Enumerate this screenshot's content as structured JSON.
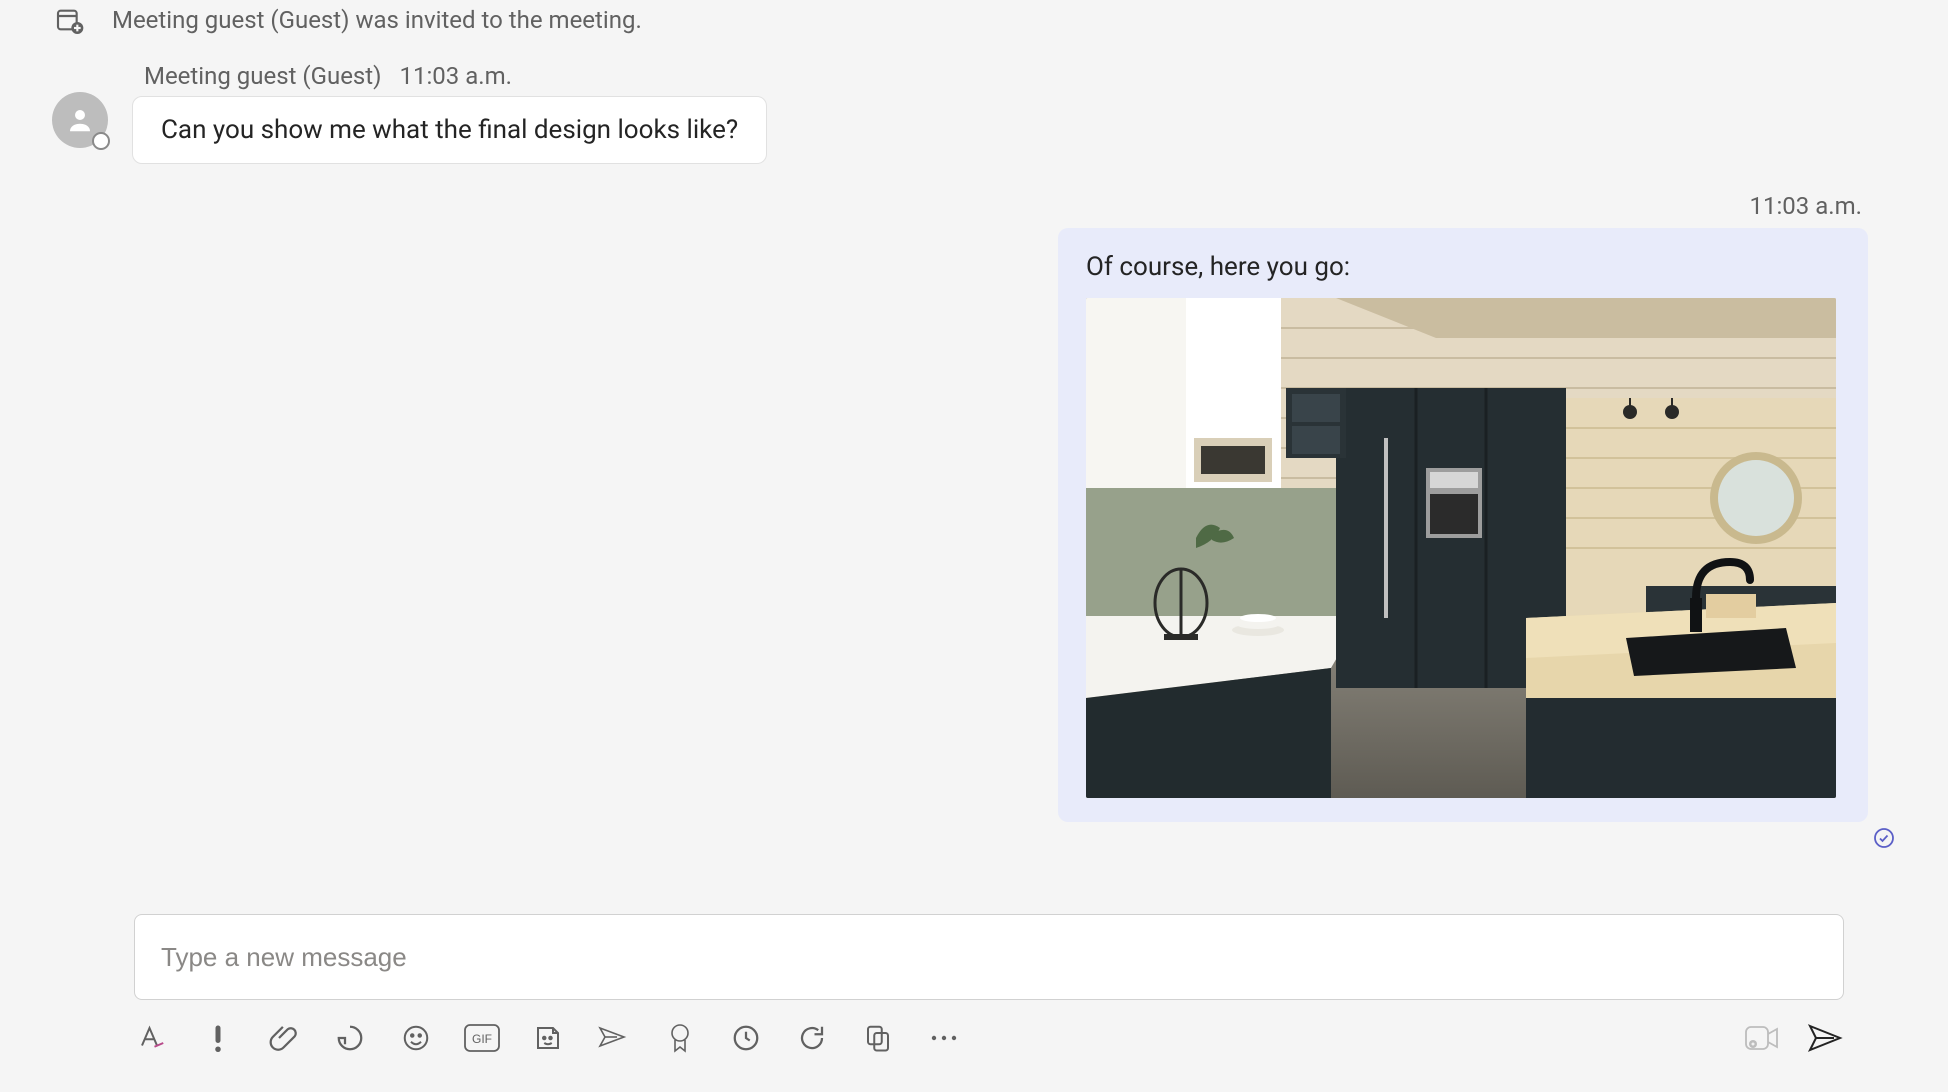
{
  "system_event_text": "Meeting guest (Guest) was invited to the meeting.",
  "received": {
    "sender": "Meeting guest (Guest)",
    "time": "11:03 a.m.",
    "text": "Can you show me what the final design looks like?"
  },
  "sent": {
    "time": "11:03 a.m.",
    "text": "Of course, here you go:",
    "image_alt": "Modern kitchen interior with dark matte cabinets, light wood countertop island, black faucet, built-in oven, and round wall mirror."
  },
  "composer": {
    "placeholder": "Type a new message"
  },
  "icons": {
    "calendar_add": "calendar-add-icon",
    "person": "person-icon",
    "seen": "eye-check-icon",
    "format_text": "format-text-icon",
    "priority": "exclamation-icon",
    "attach": "paperclip-icon",
    "loop": "loop-component-icon",
    "emoji": "emoji-icon",
    "gif": "gif-icon",
    "sticker": "sticker-icon",
    "schedule_send": "schedule-send-icon",
    "approval": "ribbon-icon",
    "viva": "circle-check-icon",
    "update": "update-arrow-icon",
    "copy": "duplicate-icon",
    "more": "more-ellipsis-icon",
    "video_clip": "video-clip-icon",
    "send": "send-icon"
  }
}
